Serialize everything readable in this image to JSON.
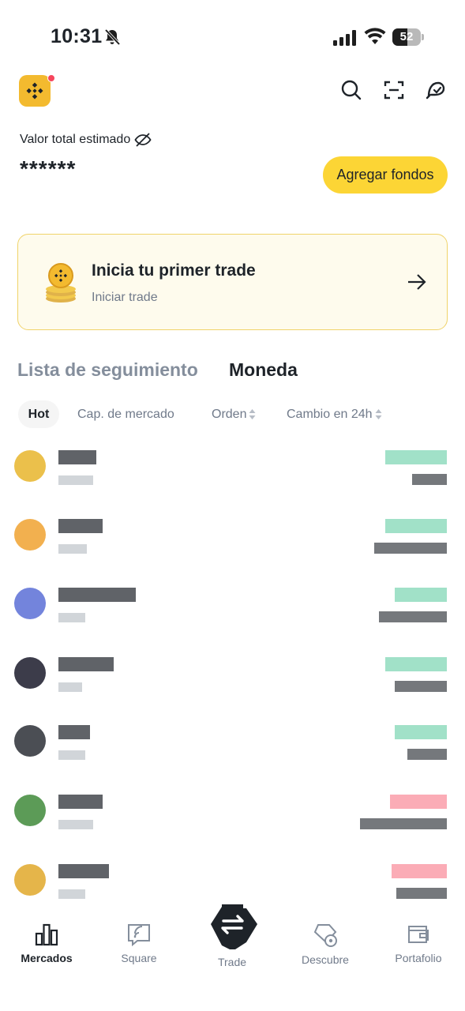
{
  "status_bar": {
    "time": "10:31",
    "battery": "52",
    "battery_level": 0.52
  },
  "header": {
    "logo": "binance-logo",
    "icons": [
      "search-icon",
      "scan-icon",
      "support-icon"
    ],
    "has_notification_dot": true
  },
  "balance": {
    "label": "Valor total estimado",
    "value": "******",
    "add_funds_label": "Agregar fondos"
  },
  "promo": {
    "title": "Inicia tu primer trade",
    "subtitle": "Iniciar trade"
  },
  "tabs": [
    {
      "label": "Lista de seguimiento",
      "active": false
    },
    {
      "label": "Moneda",
      "active": true
    }
  ],
  "filters": [
    {
      "label": "Hot",
      "active": true
    },
    {
      "label": "Cap. de mercado",
      "active": false
    },
    {
      "label": "Orden",
      "active": false,
      "sortable": true
    },
    {
      "label": "Cambio en 24h",
      "active": false,
      "sortable": true
    }
  ],
  "coins": [
    {
      "icon_color": "#e7b52c",
      "change_color": "#2ebd85"
    },
    {
      "icon_color": "#f0a230",
      "change_color": "#2ebd85"
    },
    {
      "icon_color": "#5b6fd6",
      "change_color": "#2ebd85"
    },
    {
      "icon_color": "#1a1a2a",
      "change_color": "#2ebd85"
    },
    {
      "icon_color": "#2b2f36",
      "change_color": "#2ebd85"
    },
    {
      "icon_color": "#3f8a3a",
      "change_color": "#f6465d"
    },
    {
      "icon_color": "#e0a82a",
      "change_color": "#f6465d"
    }
  ],
  "bottom_nav": {
    "items": [
      {
        "label": "Mercados",
        "icon": "bar-chart-icon",
        "active": true
      },
      {
        "label": "Square",
        "icon": "square-icon",
        "active": false
      },
      {
        "label": "Trade",
        "icon": "swap-icon",
        "active": false
      },
      {
        "label": "Descubre",
        "icon": "discover-icon",
        "active": false
      },
      {
        "label": "Portafolio",
        "icon": "wallet-icon",
        "active": false
      }
    ]
  },
  "colors": {
    "brand_yellow": "#fcd535",
    "up": "#2ebd85",
    "down": "#f6465d",
    "text": "#1e2329",
    "muted": "#707a8a"
  }
}
